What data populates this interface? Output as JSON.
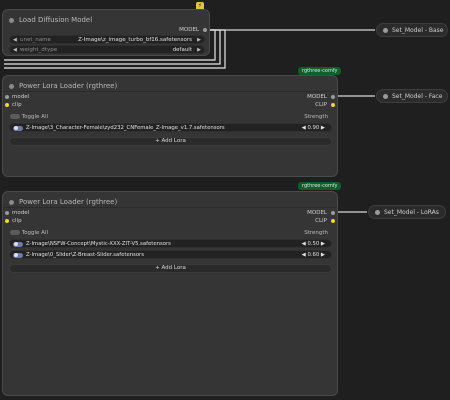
{
  "load_node": {
    "title": "Load Diffusion Model",
    "output_label": "MODEL",
    "widgets": [
      {
        "label": "unet_name",
        "value": "Z-Image\\z_image_turbo_bf16.safetensors"
      },
      {
        "label": "weight_dtype",
        "value": "default"
      }
    ]
  },
  "lora_nodes": [
    {
      "badge": "rgthree-comfy",
      "title": "Power Lora Loader (rgthree)",
      "inputs": [
        "model",
        "clip"
      ],
      "outputs": [
        "MODEL",
        "CLIP"
      ],
      "toggle_all": "Toggle All",
      "strength_header": "Strength",
      "loras": [
        {
          "name": "Z-Image\\3_Character-Female\\zyd232_CNFemale_Z-Image_v1.7.safetensors",
          "strength": "0.90"
        }
      ],
      "add_label": "+ Add Lora"
    },
    {
      "badge": "rgthree-comfy",
      "title": "Power Lora Loader (rgthree)",
      "inputs": [
        "model",
        "clip"
      ],
      "outputs": [
        "MODEL",
        "CLIP"
      ],
      "toggle_all": "Toggle All",
      "strength_header": "Strength",
      "loras": [
        {
          "name": "Z-Image\\NSFW-Concept\\Mystic-XXX-ZIT-V5.safetensors",
          "strength": "0.50"
        },
        {
          "name": "Z-Image\\0_Slider\\Z-Breast-Slider.safetensors",
          "strength": "0.60"
        }
      ],
      "add_label": "+ Add Lora"
    }
  ],
  "set_nodes": [
    {
      "label": "Set_Model - Base"
    },
    {
      "label": "Set_Model - Face"
    },
    {
      "label": "Set_Model - LoRAs"
    }
  ],
  "colors": {
    "background": "#1f1f1f",
    "node": "#353535",
    "badge": "#0f5e2a",
    "clip_socket": "#f0d050",
    "toggle": "#6f7aa8"
  }
}
